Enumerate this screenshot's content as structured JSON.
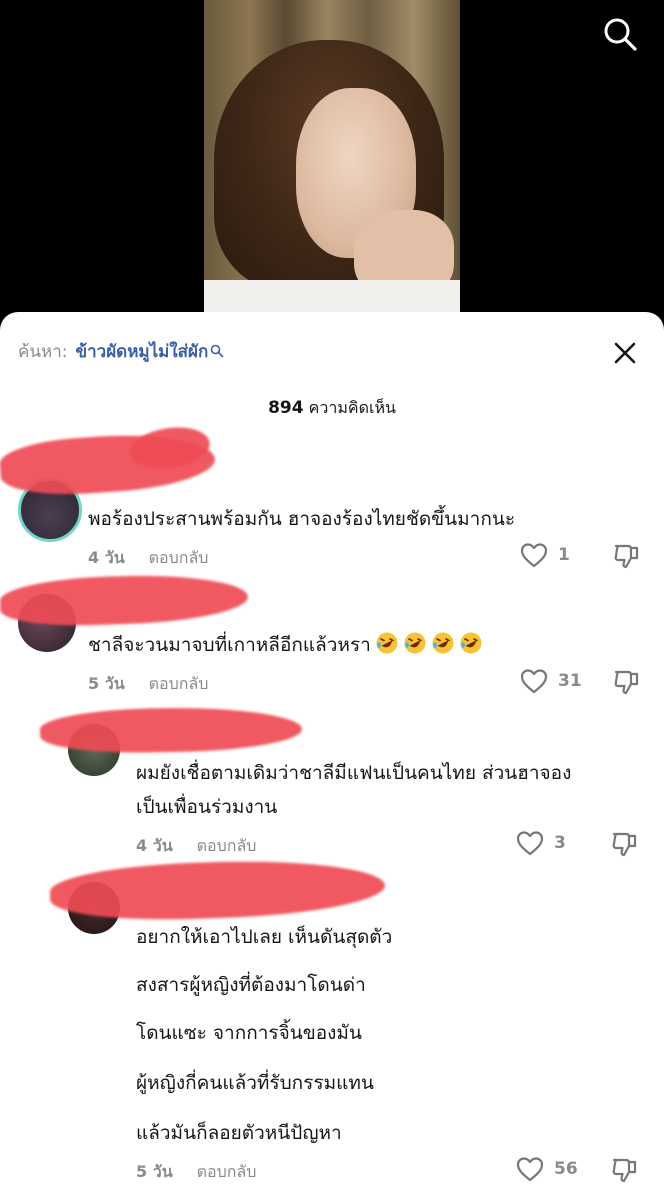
{
  "search": {
    "prefix": "ค้นหา:",
    "query": "ข้าวผัดหมูไม่ใส่ผัก"
  },
  "comments_header": {
    "count": "894",
    "label": "ความคิดเห็น"
  },
  "comments": [
    {
      "lines": [
        "พอร้องประสานพร้อมกัน ฮาจองร้องไทยชัดขึ้นมากนะ"
      ],
      "age": "4 วัน",
      "reply_label": "ตอบกลับ",
      "likes": "1"
    },
    {
      "lines": [
        "ชาลีจะวนมาจบที่เกาหลีอีกแล้วหรา"
      ],
      "emoji": [
        "rofl-emoji",
        "rofl-emoji",
        "rofl-emoji",
        "rofl-emoji"
      ],
      "age": "5 วัน",
      "reply_label": "ตอบกลับ",
      "likes": "31"
    },
    {
      "lines": [
        "ผมยังเชื่อตามเดิมว่าชาลีมีแฟนเป็นคนไทย ส่วนฮาจอง",
        "เป็นเพื่อนร่วมงาน"
      ],
      "age": "4 วัน",
      "reply_label": "ตอบกลับ",
      "likes": "3"
    },
    {
      "lines": [
        "อยากให้เอาไปเลย เห็นดันสุดตัว",
        "สงสารผู้หญิงที่ต้องมาโดนด่า",
        "โดนแซะ จากการจิ้นของมัน",
        "ผู้หญิงกี่คนแล้วที่รับกรรมแทน",
        "แล้วมันก็ลอยตัวหนีปัญหา"
      ],
      "age": "5 วัน",
      "reply_label": "ตอบกลับ",
      "likes": "56"
    }
  ],
  "colors": {
    "redaction": "#ef4c55",
    "link_blue": "#3a5fa8",
    "muted": "#8a8a8a"
  }
}
